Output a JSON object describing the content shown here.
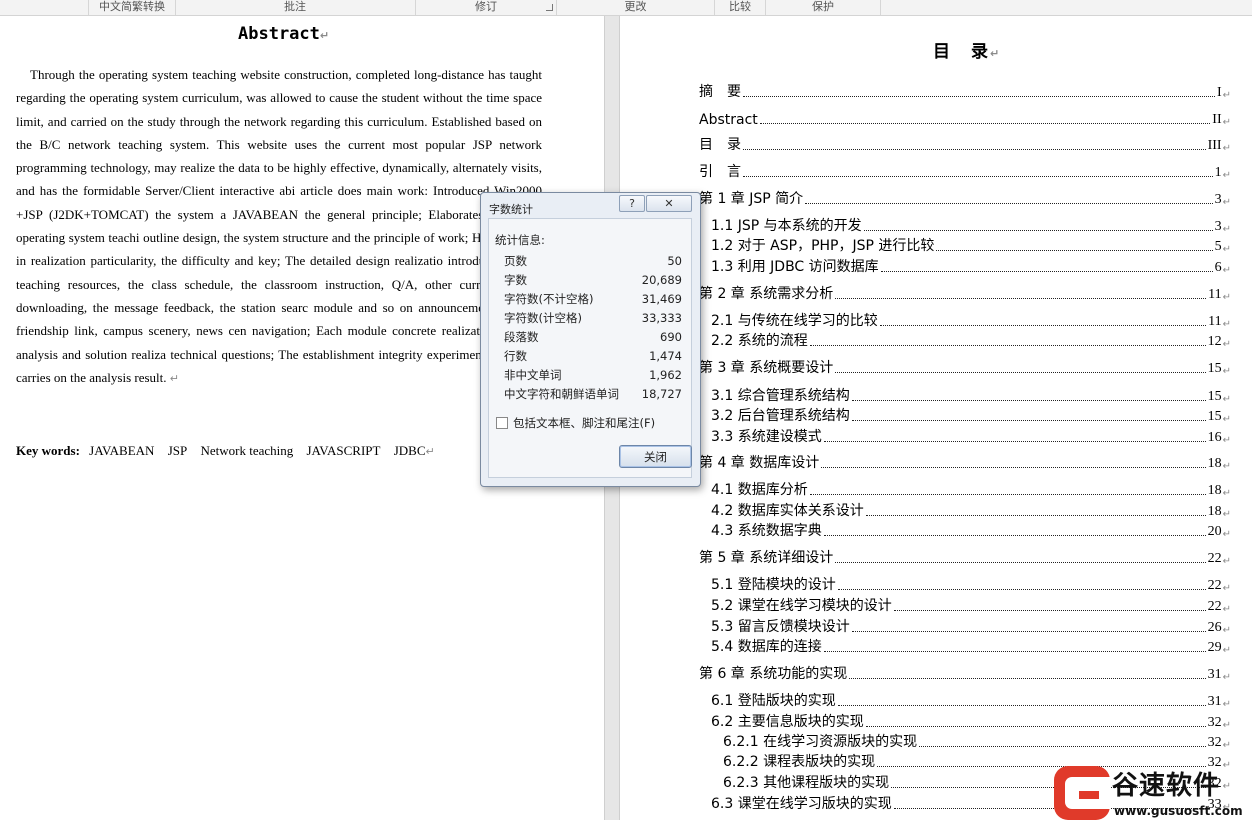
{
  "ribbon": {
    "groups": [
      "中文简繁转换",
      "批注",
      "修订",
      "更改",
      "比较",
      "保护"
    ]
  },
  "left_page": {
    "title": "Abstract",
    "paragraph_mark": "↵",
    "body": "Through the operating system teaching website construction, completed long-distance has taught regarding the operating system curriculum, was allowed to cause the student without the time space limit, and carried on the study through the network regarding this curriculum. Established based on the B/C network teaching system. This website uses the current most popular JSP network programming technology, may realize the data to be highly effective, dynamically, alternately visits, and has the formidable Server/Client interactive abi article does main work: Introduced Win2000 +JSP (J2DK+TOMCAT) the system a JAVABEAN the general principle; Elaborates the entire operating system teachi outline design, the system structure and the principle of work; Has analyzed in realization particularity, the difficulty and key; The detailed design realizatio introduced, in the teaching resources, the class schedule, the classroom instruction, Q/A, other curricula, class downloading, the message feedback, the station searc module and so on announcement column, friendship link, campus scenery, news cen navigation; Each module concrete realization, also in analysis and solution realiza technical questions; The establishment integrity experimental website, carries on the analysis result.",
    "keywords_label": "Key words:",
    "keywords": [
      "JAVABEAN",
      "JSP",
      "Network teaching",
      "JAVASCRIPT",
      "JDBC"
    ]
  },
  "toc": {
    "title": "目　录",
    "entries": [
      {
        "text": "摘　要",
        "page": "I"
      },
      {
        "text": "Abstract",
        "page": "II"
      },
      {
        "text": "目　录",
        "page": "III"
      },
      {
        "text": "引　言",
        "page": "1"
      },
      {
        "text": "第 1 章  JSP 简介",
        "page": "3"
      },
      {
        "text": "1.1 JSP 与本系统的开发",
        "page": "3"
      },
      {
        "text": "1.2 对于 ASP，PHP，JSP 进行比较",
        "page": "5"
      },
      {
        "text": "1.3 利用 JDBC 访问数据库",
        "page": "6"
      },
      {
        "text": "第 2 章 系统需求分析",
        "page": "11"
      },
      {
        "text": "2.1 与传统在线学习的比较",
        "page": "11"
      },
      {
        "text": "2.2 系统的流程",
        "page": "12"
      },
      {
        "text": "第 3 章 系统概要设计",
        "page": "15"
      },
      {
        "text": "3.1 综合管理系统结构",
        "page": "15"
      },
      {
        "text": "3.2 后台管理系统结构",
        "page": "15"
      },
      {
        "text": "3.3 系统建设模式",
        "page": "16"
      },
      {
        "text": "第 4 章 数据库设计",
        "page": "18"
      },
      {
        "text": "4.1 数据库分析",
        "page": "18"
      },
      {
        "text": "4.2 数据库实体关系设计",
        "page": "18"
      },
      {
        "text": "4.3 系统数据字典",
        "page": "20"
      },
      {
        "text": "第 5 章 系统详细设计",
        "page": "22"
      },
      {
        "text": "5.1 登陆模块的设计",
        "page": "22"
      },
      {
        "text": "5.2 课堂在线学习模块的设计",
        "page": "22"
      },
      {
        "text": "5.3 留言反馈模块设计",
        "page": "26"
      },
      {
        "text": "5.4 数据库的连接",
        "page": "29"
      },
      {
        "text": "第 6 章 系统功能的实现",
        "page": "31"
      },
      {
        "text": "6.1 登陆版块的实现",
        "page": "31"
      },
      {
        "text": "6.2 主要信息版块的实现",
        "page": "32"
      },
      {
        "text": "6.2.1 在线学习资源版块的实现",
        "page": "32"
      },
      {
        "text": "6.2.2 课程表版块的实现",
        "page": "32"
      },
      {
        "text": "6.2.3 其他课程版块的实现",
        "page": "32"
      },
      {
        "text": "6.3 课堂在线学习版块的实现",
        "page": "33"
      }
    ]
  },
  "dialog": {
    "title": "字数统计",
    "help_label": "?",
    "close_x_label": "✕",
    "stats_label": "统计信息:",
    "stats": [
      {
        "label": "页数",
        "value": "50"
      },
      {
        "label": "字数",
        "value": "20,689"
      },
      {
        "label": "字符数(不计空格)",
        "value": "31,469"
      },
      {
        "label": "字符数(计空格)",
        "value": "33,333"
      },
      {
        "label": "段落数",
        "value": "690"
      },
      {
        "label": "行数",
        "value": "1,474"
      },
      {
        "label": "非中文单词",
        "value": "1,962"
      },
      {
        "label": "中文字符和朝鲜语单词",
        "value": "18,727"
      }
    ],
    "include_label": "包括文本框、脚注和尾注(F)",
    "include_checked": false,
    "close_button": "关闭"
  },
  "watermark": {
    "text": "谷速软件",
    "url": "www.gusuosft.com",
    "color": "#e03a2a"
  }
}
